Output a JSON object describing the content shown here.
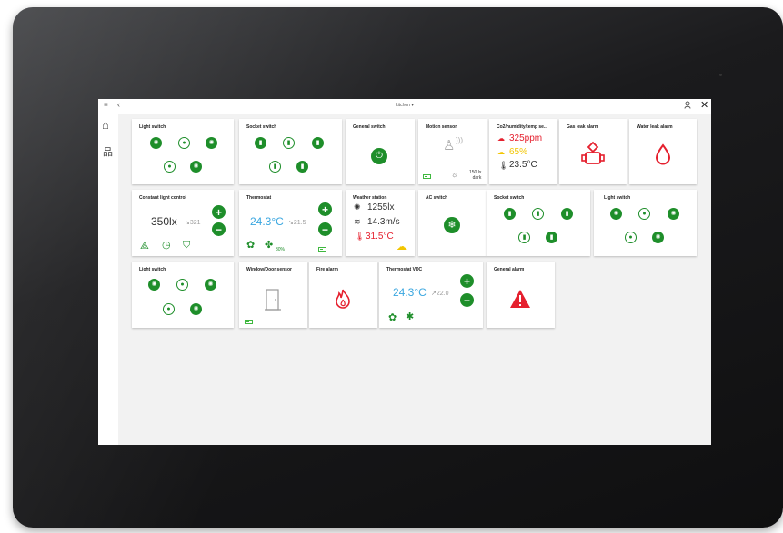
{
  "header": {
    "menu_icon": "≡",
    "back_icon": "‹",
    "room": "kitchen",
    "user_icon": "👤",
    "close_icon": "✕"
  },
  "sidebar": {
    "home_icon": "⌂",
    "network_icon": "品"
  },
  "colors": {
    "accent": "#1e8e2a",
    "alarm_red": "#e5202e",
    "blue": "#3ba7e0",
    "warn_yellow": "#f2c500"
  },
  "cards": {
    "light1": {
      "title": "Light switch"
    },
    "socket1": {
      "title": "Socket switch"
    },
    "general": {
      "title": "General switch"
    },
    "motion": {
      "title": "Motion sensor",
      "lux": "150 lx",
      "status": "dark"
    },
    "co2": {
      "title": "Co2/humidity/temp se...",
      "co2": "325ppm",
      "humidity": "65%",
      "temp": "23.5°C"
    },
    "gas": {
      "title": "Gas leak alarm"
    },
    "water": {
      "title": "Water leak alarm"
    },
    "constant": {
      "title": "Constant light control",
      "value": "350lx",
      "target": "↘321"
    },
    "thermostat1": {
      "title": "Thermostat",
      "value": "24.3°C",
      "target": "↘21.5",
      "fan": "30%"
    },
    "weather": {
      "title": "Weather station",
      "lux": "1255lx",
      "wind": "14.3m/s",
      "temp": "31.5°C"
    },
    "ac": {
      "title": "AC switch"
    },
    "socket2": {
      "title": "Socket switch"
    },
    "light2": {
      "title": "Light switch"
    },
    "light3": {
      "title": "Light switch"
    },
    "window": {
      "title": "Window/Door sensor"
    },
    "fire": {
      "title": "Fire alarm"
    },
    "thermostat_vdc": {
      "title": "Thermostat VDC",
      "value": "24.3°C",
      "target": "↗22.0"
    },
    "general_alarm": {
      "title": "General alarm"
    }
  }
}
